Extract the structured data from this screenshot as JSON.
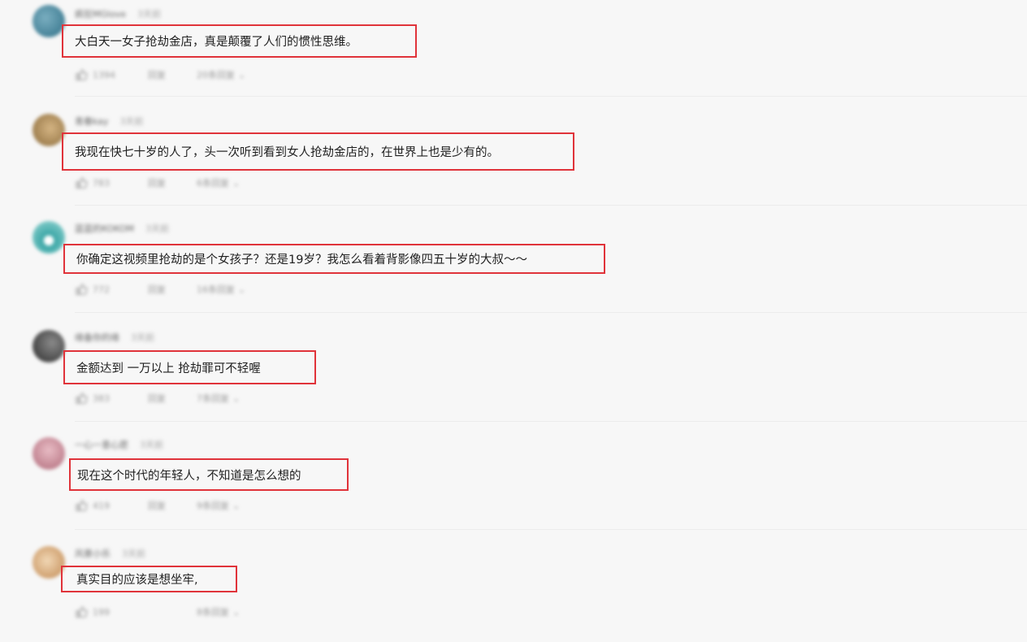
{
  "comments": [
    {
      "username": "疯狂MGlove",
      "time": "3天前",
      "text": "大白天一女子抢劫金店，真是颠覆了人们的惯性思维。",
      "likes": "1394",
      "reply_label": "回复",
      "sub_replies": "20条回复",
      "avatar_colors": [
        "#2f6f86",
        "#7aaec0"
      ]
    },
    {
      "username": "青春kay",
      "time": "3天前",
      "text": "我现在快七十岁的人了，头一次听到看到女人抢劫金店的，在世界上也是少有的。",
      "likes": "783",
      "reply_label": "回复",
      "sub_replies": "6条回复",
      "avatar_colors": [
        "#8a6a3a",
        "#d4b483"
      ]
    },
    {
      "username": "蓝蓝的KOKOM",
      "time": "3天前",
      "text": "你确定这视频里抢劫的是个女孩子？还是19岁？我怎么看着背影像四五十岁的大叔～～",
      "likes": "772",
      "reply_label": "回复",
      "sub_replies": "16条回复",
      "avatar_colors": [
        "#3aa6a6",
        "#9ad7d4"
      ]
    },
    {
      "username": "缘备你的缘",
      "time": "3天前",
      "text": "金额达到 一万以上 抢劫罪可不轻喔",
      "likes": "383",
      "reply_label": "回复",
      "sub_replies": "7条回复",
      "avatar_colors": [
        "#2a2a2a",
        "#8a8a8a"
      ]
    },
    {
      "username": "一心一意心愿",
      "time": "3天前",
      "text": "现在这个时代的年轻人，不知道是怎么想的",
      "likes": "419",
      "reply_label": "回复",
      "sub_replies": "9条回复",
      "avatar_colors": [
        "#b06a7a",
        "#e8bcc4"
      ]
    },
    {
      "username": "风景小乐",
      "time": "3天前",
      "text": "真实目的应该是想坐牢,",
      "likes": "199",
      "reply_label": "",
      "sub_replies": "8条回复",
      "avatar_colors": [
        "#c0874f",
        "#f1d7b5"
      ]
    }
  ]
}
